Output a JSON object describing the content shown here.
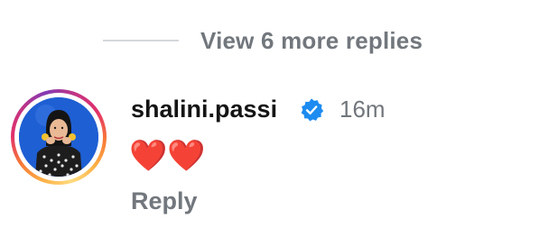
{
  "thread": {
    "view_more_label": "View 6 more replies"
  },
  "comment": {
    "username": "shalini.passi",
    "verified": true,
    "timestamp": "16m",
    "text": "❤️❤️",
    "reply_label": "Reply",
    "avatar_icon": "profile-photo",
    "verified_icon": "verified-badge-icon"
  },
  "colors": {
    "secondary_text": "#72777d",
    "primary_text": "#141414",
    "verified_blue": "#1d8bf0",
    "divider": "#d5d8dc",
    "heart_red": "#e0142e"
  }
}
